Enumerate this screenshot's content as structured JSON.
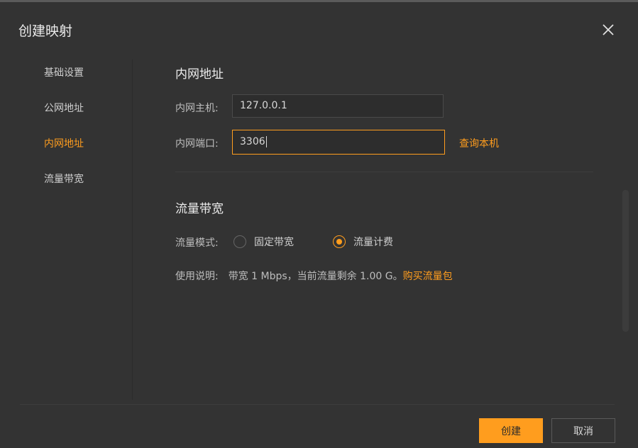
{
  "dialog": {
    "title": "创建映射"
  },
  "nav": {
    "items": [
      {
        "label": "基础设置"
      },
      {
        "label": "公网地址"
      },
      {
        "label": "内网地址",
        "active": true
      },
      {
        "label": "流量带宽"
      }
    ]
  },
  "intranet": {
    "title": "内网地址",
    "host_label": "内网主机:",
    "host_value": "127.0.0.1",
    "port_label": "内网端口:",
    "port_value": "3306",
    "query_link": "查询本机"
  },
  "bandwidth": {
    "title": "流量带宽",
    "mode_label": "流量模式:",
    "options": [
      {
        "label": "固定带宽",
        "checked": false
      },
      {
        "label": "流量计费",
        "checked": true
      }
    ],
    "desc_label": "使用说明:",
    "desc_text": "带宽 1 Mbps，当前流量剩余 1.00 G。",
    "buy_link": "购买流量包"
  },
  "footer": {
    "create_label": "创建",
    "cancel_label": "取消"
  },
  "colors": {
    "accent": "#ff9d1e",
    "background": "#333333"
  }
}
